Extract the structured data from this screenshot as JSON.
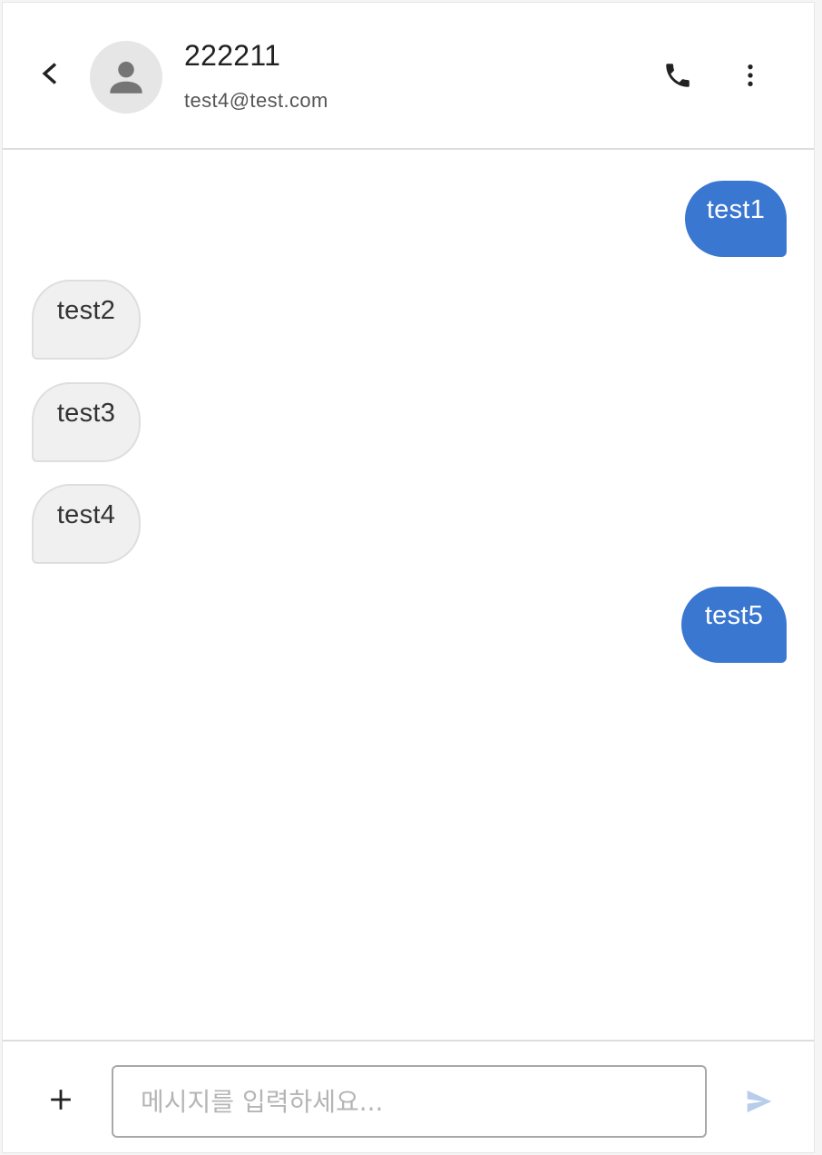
{
  "header": {
    "back_icon": "chevron-left-icon",
    "avatar_icon": "person-icon",
    "contact_name": "222211",
    "contact_email": "test4@test.com",
    "call_icon": "phone-icon",
    "more_icon": "more-vertical-icon"
  },
  "messages": [
    {
      "text": "test1",
      "direction": "sent"
    },
    {
      "text": "test2",
      "direction": "received"
    },
    {
      "text": "test3",
      "direction": "received"
    },
    {
      "text": "test4",
      "direction": "received"
    },
    {
      "text": "test5",
      "direction": "sent"
    }
  ],
  "composer": {
    "plus_icon": "plus-icon",
    "input_value": "",
    "input_placeholder": "메시지를 입력하세요...",
    "send_icon": "send-icon"
  },
  "colors": {
    "sent_bubble": "#3a77d1",
    "received_bubble": "#f0f0f0",
    "send_icon_disabled": "#b7cdea",
    "avatar_bg": "#e6e6e6"
  }
}
